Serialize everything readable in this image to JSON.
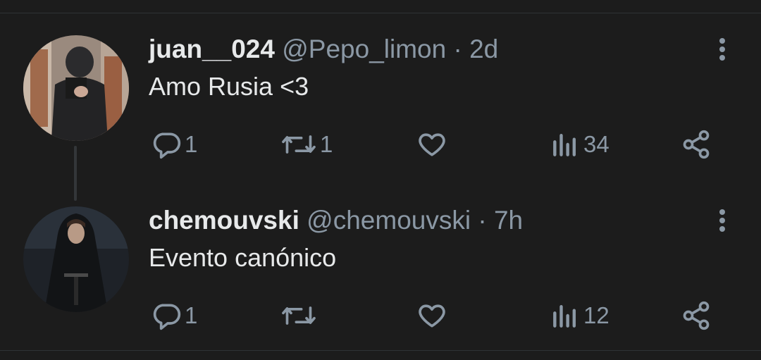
{
  "tweets": [
    {
      "display_name": "juan__024",
      "handle": "@Pepo_limon",
      "separator": "·",
      "time": "2d",
      "text": "Amo Rusia <3",
      "replies": "1",
      "retweets": "1",
      "likes": "",
      "views": "34",
      "avatar": "mirror-selfie-photo"
    },
    {
      "display_name": "chemouvski",
      "handle": "@chemouvski",
      "separator": "·",
      "time": "7h",
      "text": "Evento canónico",
      "replies": "1",
      "retweets": "",
      "likes": "",
      "views": "12",
      "avatar": "hooded-figure-photo"
    }
  ],
  "icons": {
    "reply": "reply-icon",
    "retweet": "retweet-icon",
    "like": "heart-icon",
    "views": "views-icon",
    "share": "share-icon",
    "more": "more-vertical-icon"
  },
  "colors": {
    "background": "#1c1c1c",
    "text_primary": "#e7e9ea",
    "text_secondary": "#8b98a5",
    "divider": "#2f3336"
  }
}
